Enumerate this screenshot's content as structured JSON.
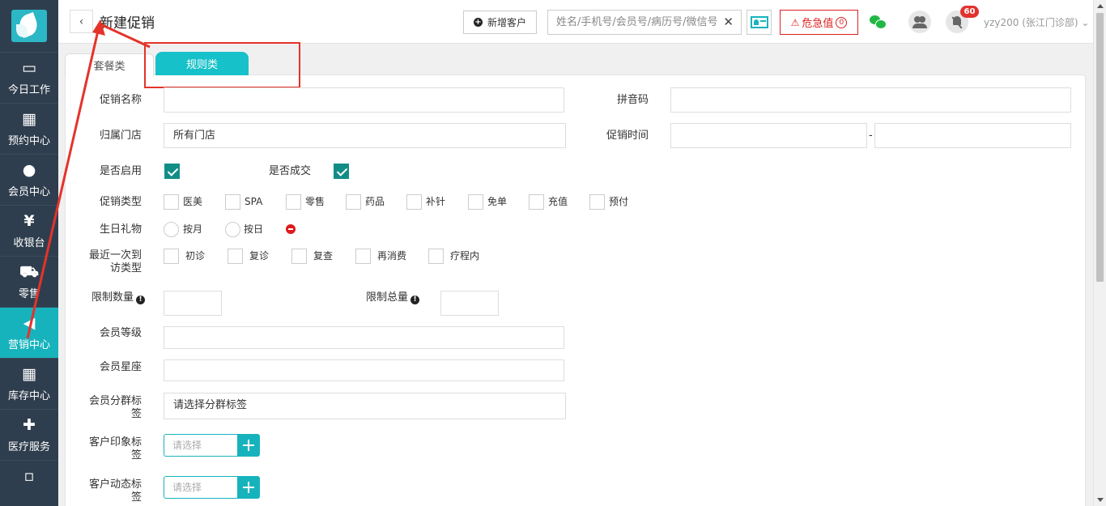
{
  "sidebar": {
    "items": [
      {
        "label": "今日工作",
        "icon": "laptop-icon",
        "glyph": "▭"
      },
      {
        "label": "预约中心",
        "icon": "calendar-icon",
        "glyph": "▦"
      },
      {
        "label": "会员中心",
        "icon": "users-icon",
        "glyph": "●"
      },
      {
        "label": "收银台",
        "icon": "yen-icon",
        "glyph": "¥"
      },
      {
        "label": "零售",
        "icon": "cart-icon",
        "glyph": "⛟"
      },
      {
        "label": "营销中心",
        "icon": "megaphone-icon",
        "glyph": "◀"
      },
      {
        "label": "库存中心",
        "icon": "grid-icon",
        "glyph": "▦"
      },
      {
        "label": "医疗服务",
        "icon": "medkit-icon",
        "glyph": "✚"
      },
      {
        "icon": "more-icon",
        "glyph": "▫"
      }
    ],
    "active_index": 5
  },
  "header": {
    "back_glyph": "‹",
    "title": "新建促销",
    "add_customer_label": "新增客户",
    "search_placeholder": "姓名/手机号/会员号/病历号/微信号",
    "search_clear": "✕",
    "critical_label": "危急值",
    "critical_count": "0",
    "notification_count": "60",
    "user_label": "yzy200 (张江门诊部)",
    "user_chevron": "⌄"
  },
  "tabs": [
    {
      "label": "套餐类",
      "active": false
    },
    {
      "label": "规则类",
      "active": true
    }
  ],
  "form": {
    "promo_name_label": "促销名称",
    "promo_name_value": "",
    "pinyin_label": "拼音码",
    "pinyin_value": "",
    "store_label": "归属门店",
    "store_value": "所有门店",
    "time_label": "促销时间",
    "time_start": "",
    "time_sep": "-",
    "time_end": "",
    "enabled_label": "是否启用",
    "enabled_checked": true,
    "deal_label": "是否成交",
    "deal_checked": true,
    "type_label": "促销类型",
    "type_options": [
      "医美",
      "SPA",
      "零售",
      "药品",
      "补针",
      "免单",
      "充值",
      "预付"
    ],
    "birthday_label": "生日礼物",
    "birthday_options": [
      "按月",
      "按日"
    ],
    "visit_label_line1": "最近一次到",
    "visit_label_line2": "访类型",
    "visit_options": [
      "初诊",
      "复诊",
      "复查",
      "再消费",
      "疗程内"
    ],
    "limit_qty_label": "限制数量",
    "limit_total_label": "限制总量",
    "info_glyph": "!",
    "level_label": "会员等级",
    "zodiac_label": "会员星座",
    "group_tag_label_line1": "会员分群标",
    "group_tag_label_line2": "签",
    "group_tag_placeholder": "请选择分群标签",
    "impression_label_line1": "客户印象标",
    "impression_label_line2": "签",
    "impression_placeholder": "请选择",
    "dynamic_label_line1": "客户动态标",
    "dynamic_label_line2": "签",
    "dynamic_placeholder": "请选择"
  },
  "colors": {
    "sidebar_bg": "#2f3e4e",
    "accent": "#17b3bd",
    "tab_active": "#17c1c9",
    "checkbox_checked": "#128d86",
    "danger": "#e5332a"
  }
}
